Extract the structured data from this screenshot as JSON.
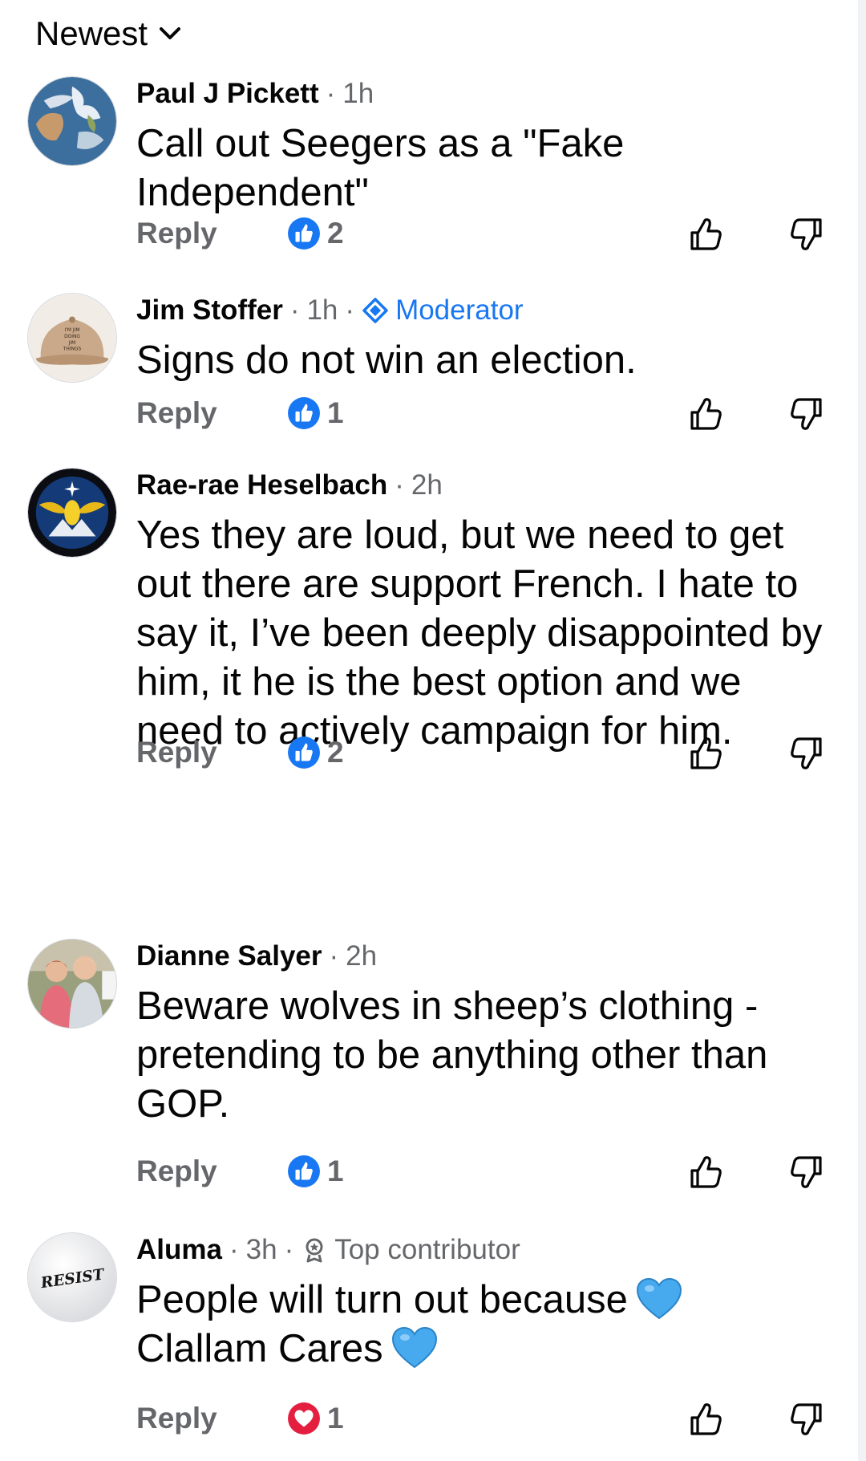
{
  "sort": {
    "label": "Newest"
  },
  "colors": {
    "meta_gray": "#65676b",
    "text": "#050505",
    "accent_blue": "#1877f2",
    "love_red": "#e41e3f"
  },
  "comments": [
    {
      "author": "Paul J Pickett",
      "sep": "·",
      "time": "1h",
      "text": "Call out Seegers as a \"Fake Independent\"",
      "reply": "Reply",
      "reaction": "like",
      "reaction_count": "2"
    },
    {
      "author": "Jim Stoffer",
      "sep": "·",
      "time": "1h",
      "sep2": "·",
      "badge": "Moderator",
      "avatar_text": [
        "I'M JIM",
        "DOING",
        "JIM",
        "THINGS"
      ],
      "text": "Signs do not win an election.",
      "reply": "Reply",
      "reaction": "like",
      "reaction_count": "1"
    },
    {
      "author": "Rae-rae Heselbach",
      "sep": "·",
      "time": "2h",
      "text": "Yes they are loud, but we need to get out there are support French. I hate to say it, I’ve been deeply disappointed by him,  it he is the best option and we need to actively campaign for him.",
      "reply": "Reply",
      "reaction": "like",
      "reaction_count": "2"
    },
    {
      "author": "Dianne Salyer",
      "sep": "·",
      "time": "2h",
      "text": "Beware wolves in sheep’s clothing - pretending to be anything other than GOP.",
      "reply": "Reply",
      "reaction": "like",
      "reaction_count": "1"
    },
    {
      "author": "Aluma",
      "sep": "·",
      "time": "3h",
      "sep2": "·",
      "badge": "Top contributor",
      "avatar_text": "RESIST",
      "text_a": "People will turn out because",
      "text_b": "Clallam Cares",
      "reply": "Reply",
      "reaction": "love",
      "reaction_count": "1"
    }
  ]
}
